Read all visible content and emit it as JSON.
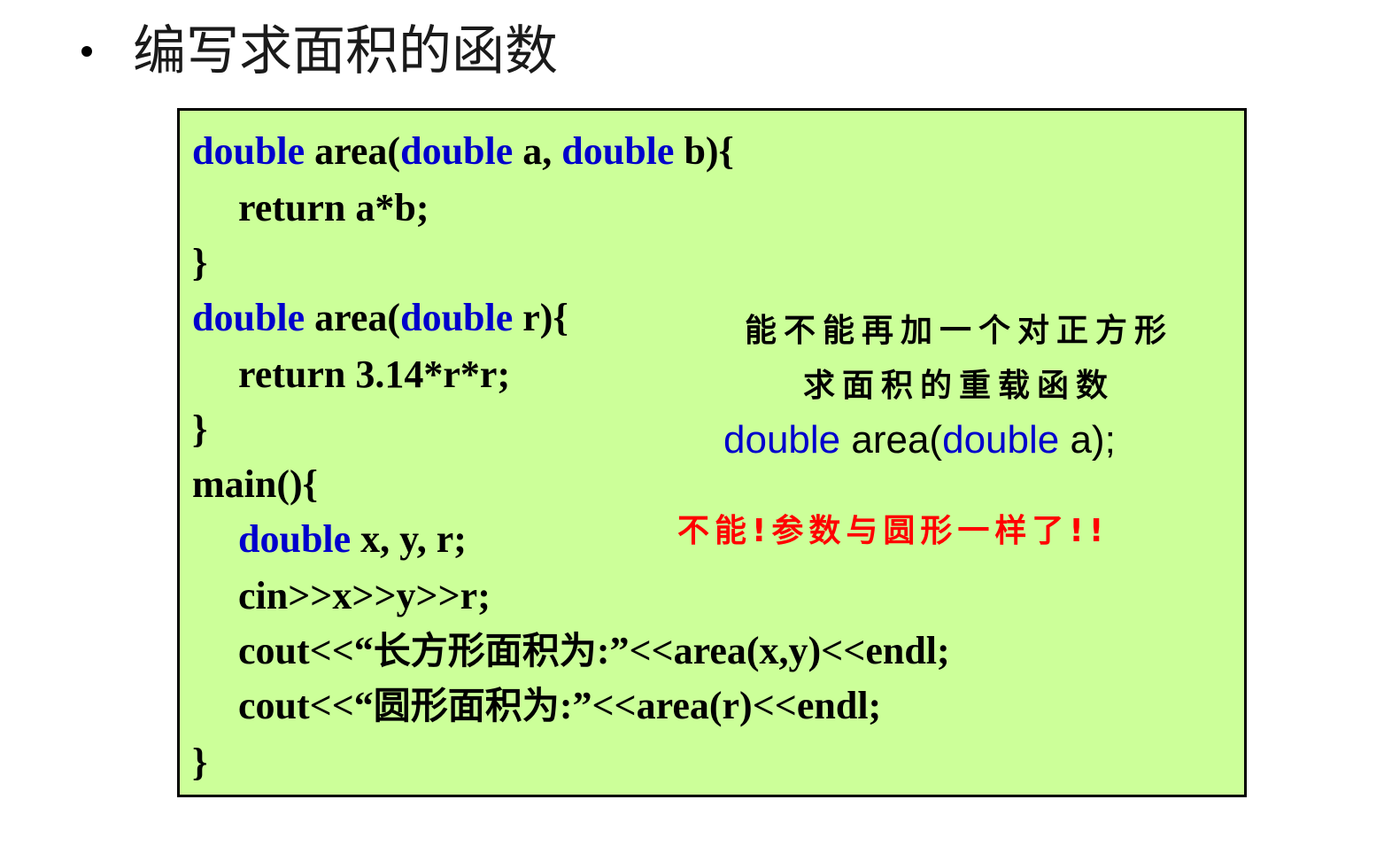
{
  "heading": "编写求面积的函数",
  "code": {
    "l1": {
      "t1": "double",
      "t2": " area(",
      "t3": "double",
      "t4": " a, ",
      "t5": "double",
      "t6": " b){"
    },
    "l2": "return a*b;",
    "l3": "}",
    "l4": {
      "t1": "double",
      "t2": " area(",
      "t3": "double",
      "t4": " r){"
    },
    "l5": "return 3.14*r*r;",
    "l6": "}",
    "l7": "main(){",
    "l8": {
      "t1": "double",
      "t2": " x, y, r;"
    },
    "l9": "cin>>x>>y>>r;",
    "l10": {
      "t1": "cout<<“",
      "t2": "长方形面积为",
      "t3": ":”<<area(x,y)<<endl;"
    },
    "l11": {
      "t1": "cout<<“",
      "t2": "圆形面积为",
      "t3": ":”<<area(r)<<endl;"
    },
    "l12": "}"
  },
  "note": {
    "line1": "能不能再加一个对正方形",
    "line2": "求面积的重载函数",
    "code": {
      "t1": "double",
      "t2": " area(",
      "t3": "double",
      "t4": " a);"
    }
  },
  "answer": "不能!参数与圆形一样了!!",
  "colors": {
    "background": "#ccff99",
    "keyword": "#0000cc",
    "answer": "#ff0000"
  }
}
